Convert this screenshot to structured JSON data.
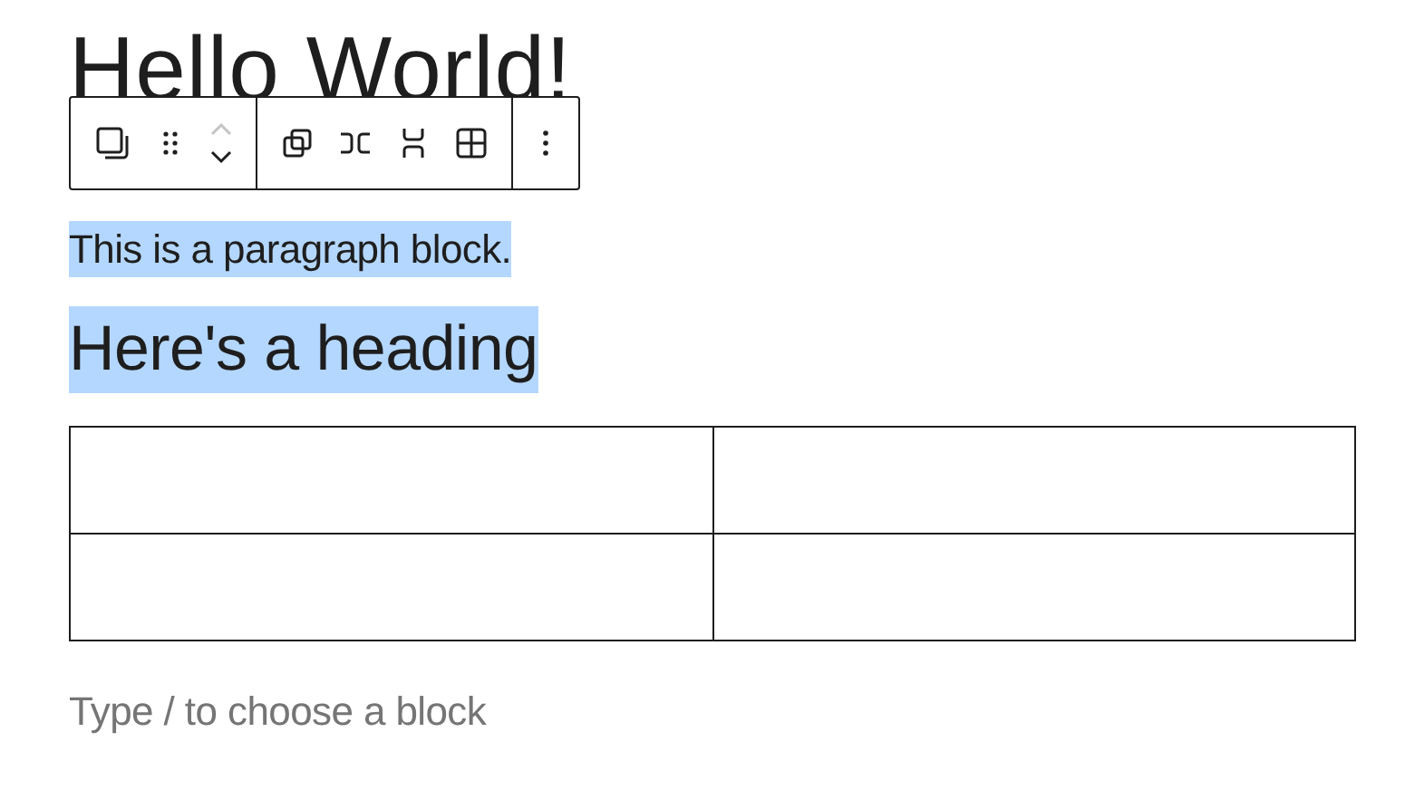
{
  "title": "Hello World!",
  "toolbar": {
    "move_up": {
      "disabled": true
    },
    "move_down": {
      "disabled": false
    }
  },
  "blocks": [
    {
      "kind": "paragraph",
      "text": "This is a paragraph block.",
      "selected": true
    },
    {
      "kind": "heading",
      "text": "Here's a heading",
      "selected": true
    },
    {
      "kind": "table",
      "rows": [
        {
          "cells": [
            {
              "selected": false
            },
            {
              "selected": false
            }
          ]
        },
        {
          "cells": [
            {
              "selected": false
            },
            {
              "selected": false
            }
          ]
        }
      ]
    }
  ],
  "appender": {
    "placeholder": "Type / to choose a block"
  }
}
